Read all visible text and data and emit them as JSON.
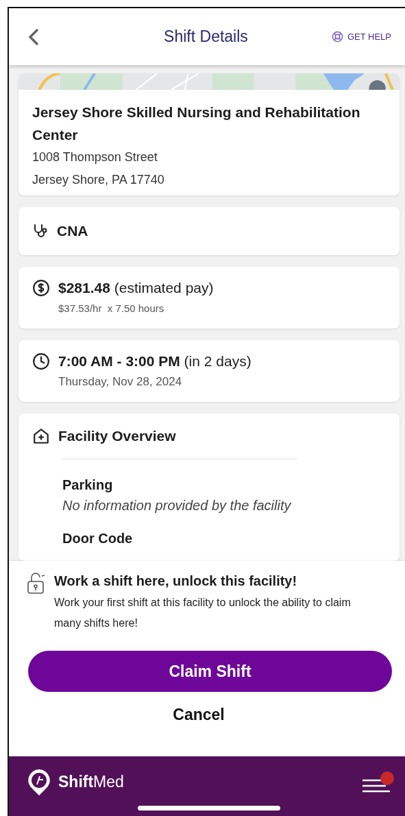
{
  "header": {
    "title": "Shift Details",
    "help": "GET HELP"
  },
  "facility": {
    "name": "Jersey Shore Skilled Nursing and Rehabilitation Center",
    "address_line_1": "1008 Thompson Street",
    "address_line_2": "Jersey Shore, PA 17740"
  },
  "cards": [
    {
      "kind": "role",
      "title": "CNA"
    },
    {
      "kind": "pay",
      "title": "$281.48",
      "note": "(estimated pay)",
      "detail": "$37.53/hr  x 7.50 hours"
    },
    {
      "kind": "time",
      "title": "7:00 AM - 3:00 PM",
      "note": "(in 2 days)",
      "detail": "Thursday, Nov 28, 2024"
    }
  ],
  "overview": {
    "title": "Facility Overview",
    "sections": [
      {
        "label": "Parking",
        "value": "No information provided by the facility"
      },
      {
        "label": "Door Code"
      }
    ]
  },
  "unlock": {
    "title": "Work a shift here, unlock this facility!",
    "body": "Work your first shift at this facility to unlock the ability to claim many shifts here!"
  },
  "buttons": {
    "primary": "Claim Shift",
    "secondary": "Cancel"
  },
  "footer": {
    "brand_bold": "Shift",
    "brand_light": "Med",
    "notification": true
  }
}
